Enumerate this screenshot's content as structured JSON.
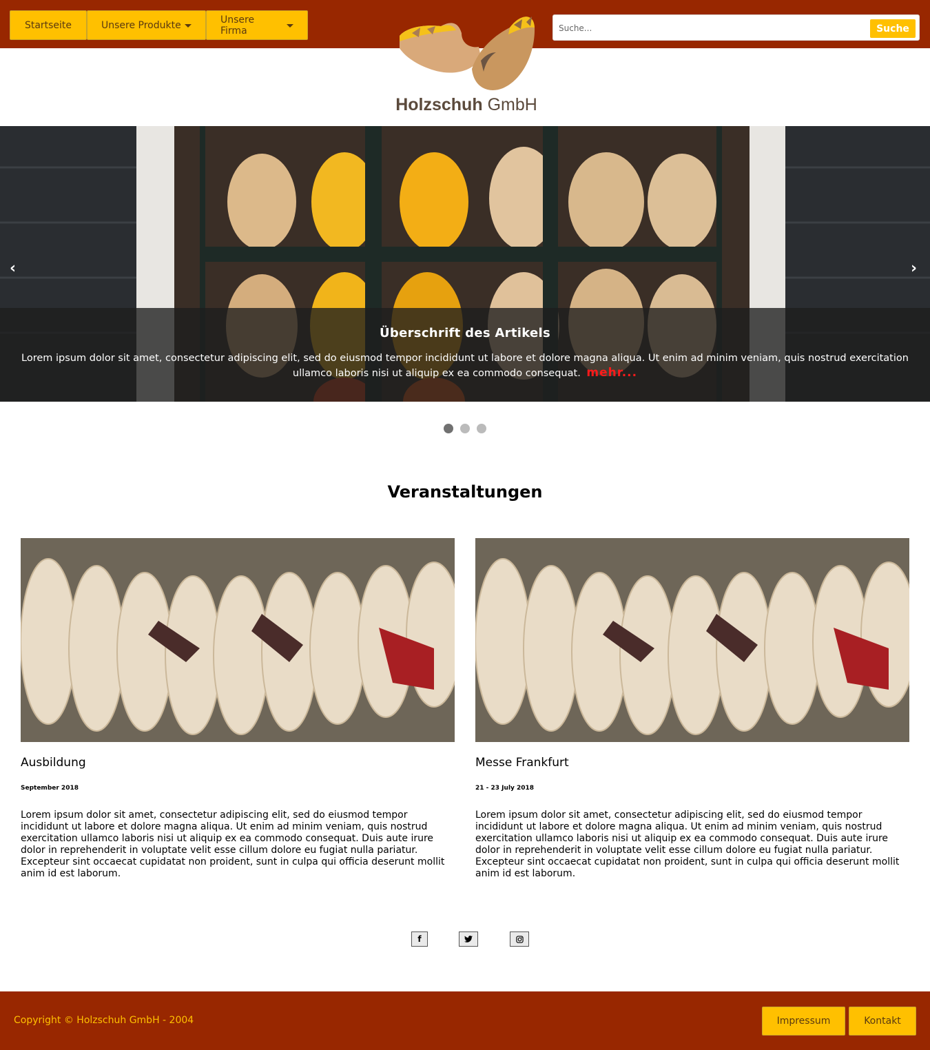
{
  "header": {
    "nav": [
      {
        "label": "Startseite"
      },
      {
        "label": "Unsere Produkte"
      },
      {
        "label": "Unsere Firma"
      }
    ],
    "search": {
      "placeholder": "Suche...",
      "button_label": "Suche"
    },
    "logo": {
      "text_bold": "Holzschuh",
      "text_regular": "GmbH"
    }
  },
  "slider": {
    "prev_icon": "‹",
    "next_icon": "›",
    "title": "Überschrift des Artikels",
    "text": "Lorem ipsum dolor sit amet, consectetur adipiscing elit, sed do eiusmod tempor incididunt ut labore et dolore magna aliqua. Ut enim ad minim veniam, quis nostrud exercitation ullamco laboris nisi ut aliquip ex ea commodo consequat.",
    "more_label": "mehr...",
    "slide_count": 3,
    "active_slide": 1
  },
  "events": {
    "title": "Veranstaltungen",
    "items": [
      {
        "title": "Ausbildung",
        "date": "September 2018",
        "text": "Lorem ipsum dolor sit amet, consectetur adipiscing elit, sed do eiusmod tempor incididunt ut labore et dolore magna aliqua. Ut enim ad minim veniam, quis nostrud exercitation ullamco laboris nisi ut aliquip ex ea commodo consequat. Duis aute irure dolor in reprehenderit in voluptate velit esse cillum dolore eu fugiat nulla pariatur. Excepteur sint occaecat cupidatat non proident, sunt in culpa qui officia deserunt mollit anim id est laborum."
      },
      {
        "title": "Messe Frankfurt",
        "date": "21 - 23 July 2018",
        "text": "Lorem ipsum dolor sit amet, consectetur adipiscing elit, sed do eiusmod tempor incididunt ut labore et dolore magna aliqua. Ut enim ad minim veniam, quis nostrud exercitation ullamco laboris nisi ut aliquip ex ea commodo consequat. Duis aute irure dolor in reprehenderit in voluptate velit esse cillum dolore eu fugiat nulla pariatur. Excepteur sint occaecat cupidatat non proident, sunt in culpa qui officia deserunt mollit anim id est laborum."
      }
    ]
  },
  "social": [
    {
      "name": "facebook-icon",
      "glyph": "f"
    },
    {
      "name": "twitter-icon",
      "glyph": "🐦"
    },
    {
      "name": "instagram-icon",
      "glyph": "◎"
    }
  ],
  "footer": {
    "copyright": "Copyright © Holzschuh GmbH - 2004",
    "impressum_label": "Impressum",
    "kontakt_label": "Kontakt"
  },
  "colors": {
    "brand": "#982700",
    "accent": "#ffc000"
  }
}
